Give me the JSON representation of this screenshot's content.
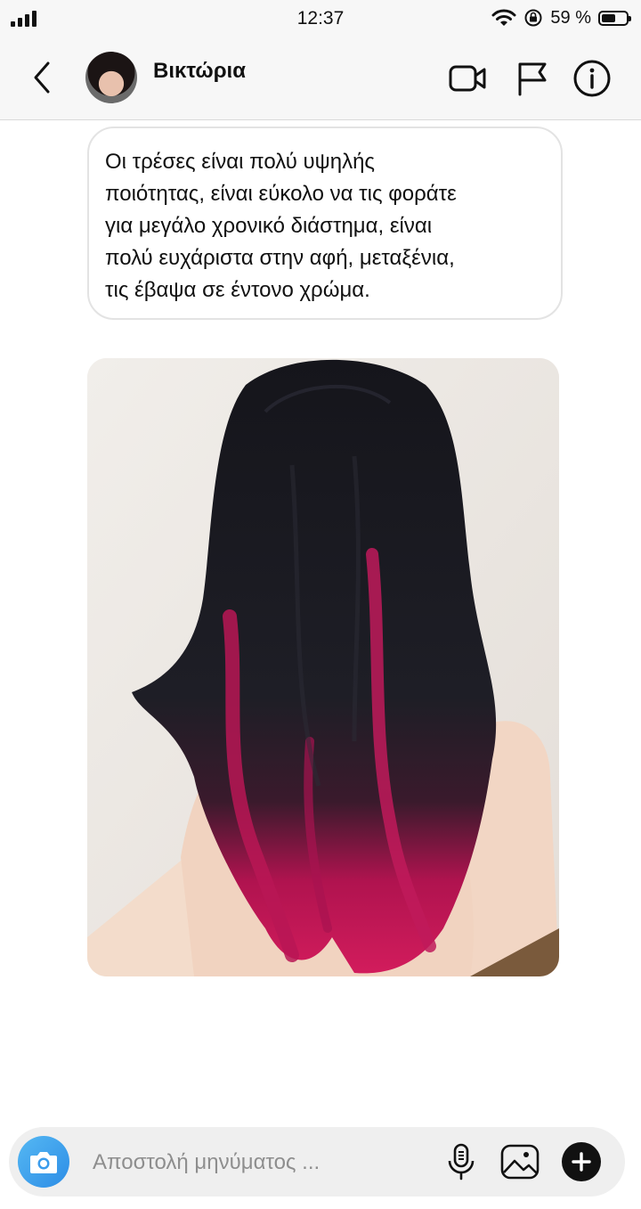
{
  "status_bar": {
    "time": "12:37",
    "battery_percent_text": "59 %",
    "battery_level": 0.59,
    "icons": [
      "cellular-signal-icon",
      "wifi-icon",
      "orientation-lock-icon",
      "battery-icon"
    ]
  },
  "header": {
    "contact_name": "Βικτώρια",
    "icons": [
      "back-chevron-icon",
      "avatar",
      "video-call-icon",
      "flag-icon",
      "info-icon"
    ]
  },
  "messages": [
    {
      "type": "text",
      "text": "Οι τρέσες είναι πολύ υψηλής\nποιότητας, είναι εύκολο να τις φοράτε\nγια μεγάλο χρονικό διάστημα, είναι\nπολύ ευχάριστα στην αφή, μεταξένια,\nτις έβαψα σε έντονο χρώμα."
    },
    {
      "type": "image",
      "subject": "long-hair-photo"
    }
  ],
  "composer": {
    "placeholder": "Αποστολή μηνύματος ...",
    "value": "",
    "icons": [
      "camera-icon",
      "microphone-icon",
      "gallery-icon",
      "plus-icon"
    ]
  },
  "colors": {
    "bar_background": "#f7f7f7",
    "camera_button": "#3a9cec",
    "hair_accent": "#c2185b",
    "hair_dark": "#1a1a22"
  }
}
